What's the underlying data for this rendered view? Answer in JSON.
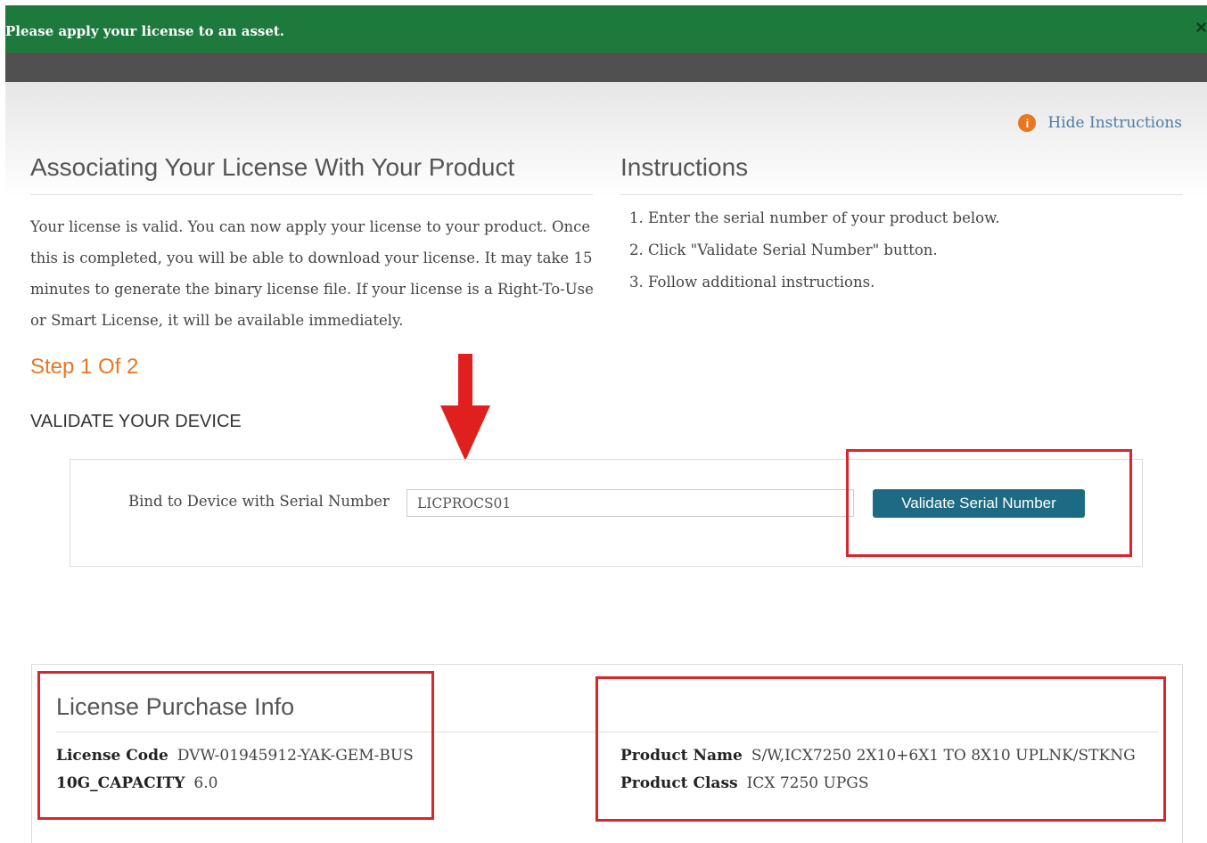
{
  "banner": {
    "message": "Please apply your license to an asset.",
    "close": "×"
  },
  "header": {
    "hide_instructions": "Hide Instructions"
  },
  "association": {
    "title": "Associating Your License With Your Product",
    "description": "Your license is valid. You can now apply your license to your product. Once this is completed, you will be able to download your license.  It may take 15 minutes to generate the binary license file.  If your license is a Right-To-Use or Smart License, it will be available immediately."
  },
  "instructions": {
    "title": "Instructions",
    "steps": [
      "1. Enter the serial number of your product below.",
      "2. Click \"Validate Serial Number\" button.",
      "3. Follow additional instructions."
    ]
  },
  "step": {
    "label": "Step 1 Of 2",
    "subtitle": "VALIDATE YOUR DEVICE"
  },
  "device": {
    "bind_label": "Bind to Device with Serial Number",
    "serial_value": "LICPROCS01",
    "validate_button": "Validate Serial Number"
  },
  "purchase": {
    "title": "License Purchase Info",
    "license_code_label": "License Code",
    "license_code_value": "DVW-01945912-YAK-GEM-BUS",
    "capacity_label": "10G_CAPACITY",
    "capacity_value": "6.0",
    "product_name_label": "Product Name",
    "product_name_value": "S/W,ICX7250 2X10+6X1 TO 8X10 UPLNK/STKNG",
    "product_class_label": "Product Class",
    "product_class_value": "ICX 7250 UPGS"
  },
  "colors": {
    "banner": "#1d7a3c",
    "accent_orange": "#e87722",
    "button": "#1d6a85",
    "highlight_red": "#d9252c",
    "link": "#4a7ea8"
  }
}
